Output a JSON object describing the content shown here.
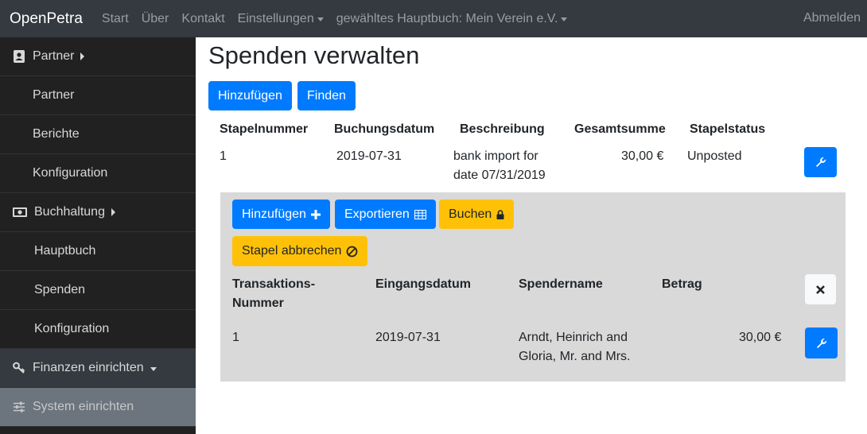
{
  "navbar": {
    "brand": "OpenPetra",
    "links": [
      "Start",
      "Über",
      "Kontakt",
      "Einstellungen",
      "gewähltes Hauptbuch: Mein Verein e.V."
    ],
    "logout": "Abmelden"
  },
  "sidebar": {
    "partner": "Partner",
    "partner_items": [
      "Partner",
      "Berichte",
      "Konfiguration"
    ],
    "buchhaltung": "Buchhaltung",
    "buchhaltung_items": [
      "Hauptbuch",
      "Spenden",
      "Konfiguration"
    ],
    "finanzen": "Finanzen einrichten",
    "system": "System einrichten"
  },
  "main": {
    "title": "Spenden verwalten",
    "add_label": "Hinzufügen",
    "find_label": "Finden",
    "columns": [
      "Stapelnummer",
      "Buchungsdatum",
      "Beschreibung",
      "Gesamtsumme",
      "Stapelstatus"
    ],
    "batch": {
      "number": "1",
      "date": "2019-07-31",
      "description_line1": "bank import for",
      "description_line2": "date 07/31/2019",
      "total": "30,00 €",
      "status": "Unposted"
    }
  },
  "detail": {
    "add_label": "Hinzufügen",
    "export_label": "Exportieren",
    "post_label": "Buchen",
    "cancel_label": "Stapel abbrechen",
    "columns": {
      "trans_line1": "Transaktions-",
      "trans_line2": "Nummer",
      "received": "Eingangsdatum",
      "donor": "Spendername",
      "amount": "Betrag"
    },
    "row": {
      "number": "1",
      "date": "2019-07-31",
      "donor_line1": "Arndt, Heinrich and",
      "donor_line2": "Gloria, Mr. and Mrs.",
      "amount": "30,00 €"
    }
  },
  "colors": {
    "navbar": "#343a40",
    "sidebar": "#212121",
    "primary": "#007bff",
    "warning": "#ffc107",
    "detail_bg": "#d9d9d9"
  }
}
